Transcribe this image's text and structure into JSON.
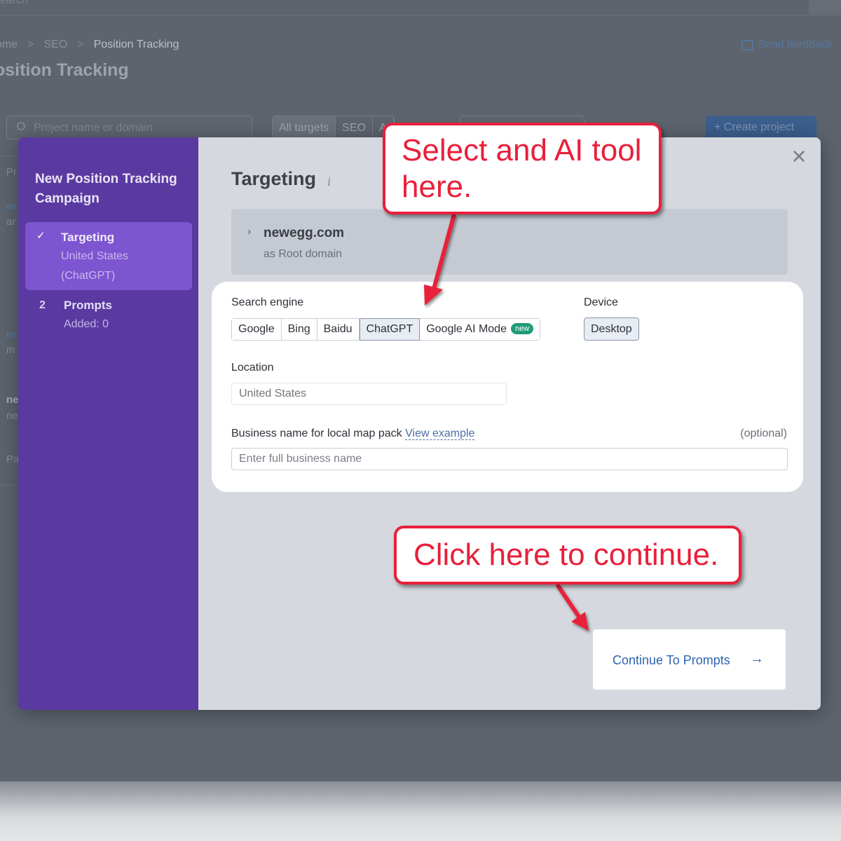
{
  "background": {
    "top_search_text": "earch",
    "breadcrumb": [
      "ome",
      "SEO",
      "Position Tracking"
    ],
    "breadcrumb_separator": ">",
    "send_feedback": "Send feedback",
    "page_title": "osition Tracking",
    "search_placeholder": "Project name or domain",
    "tabs": [
      "All targets",
      "SEO",
      "A"
    ],
    "create_project": "+  Create project",
    "row_labels": [
      "Pr",
      "ar",
      "ar",
      "m",
      "m",
      "ne",
      "ne",
      "Pa"
    ]
  },
  "modal": {
    "sidebar": {
      "title": "New Position Tracking Campaign",
      "step1": {
        "check": "✓",
        "title": "Targeting",
        "subtitle_line1": "United States",
        "subtitle_line2": "(ChatGPT)"
      },
      "step2": {
        "number": "2",
        "title": "Prompts",
        "subtitle": "Added: 0"
      }
    },
    "close_symbol": "×",
    "heading": "Targeting",
    "info_symbol": "i",
    "domain": {
      "chevron": "›",
      "name": "newegg.com",
      "type": "as Root domain"
    },
    "form": {
      "search_engine_label": "Search engine",
      "engines": [
        "Google",
        "Bing",
        "Baidu",
        "ChatGPT",
        "Google AI Mode"
      ],
      "selected_engine": "ChatGPT",
      "new_badge": "new",
      "device_label": "Device",
      "device_value": "Desktop",
      "location_label": "Location",
      "location_placeholder": "United States",
      "business_label": "Business name for local map pack",
      "view_example": "View example",
      "optional": "(optional)",
      "business_placeholder": "Enter full business name"
    },
    "continue_button": {
      "label": "Continue To Prompts",
      "arrow": "→"
    }
  },
  "callouts": {
    "callout1_line1": "Select and AI tool",
    "callout1_line2": "here.",
    "callout2": "Click here to continue."
  },
  "colors": {
    "sidebar": "#5a3aa0",
    "active_step": "#7d55d0",
    "callout_red": "#e8203b",
    "link_blue": "#2f64b0",
    "new_badge": "#1f9d7a"
  }
}
